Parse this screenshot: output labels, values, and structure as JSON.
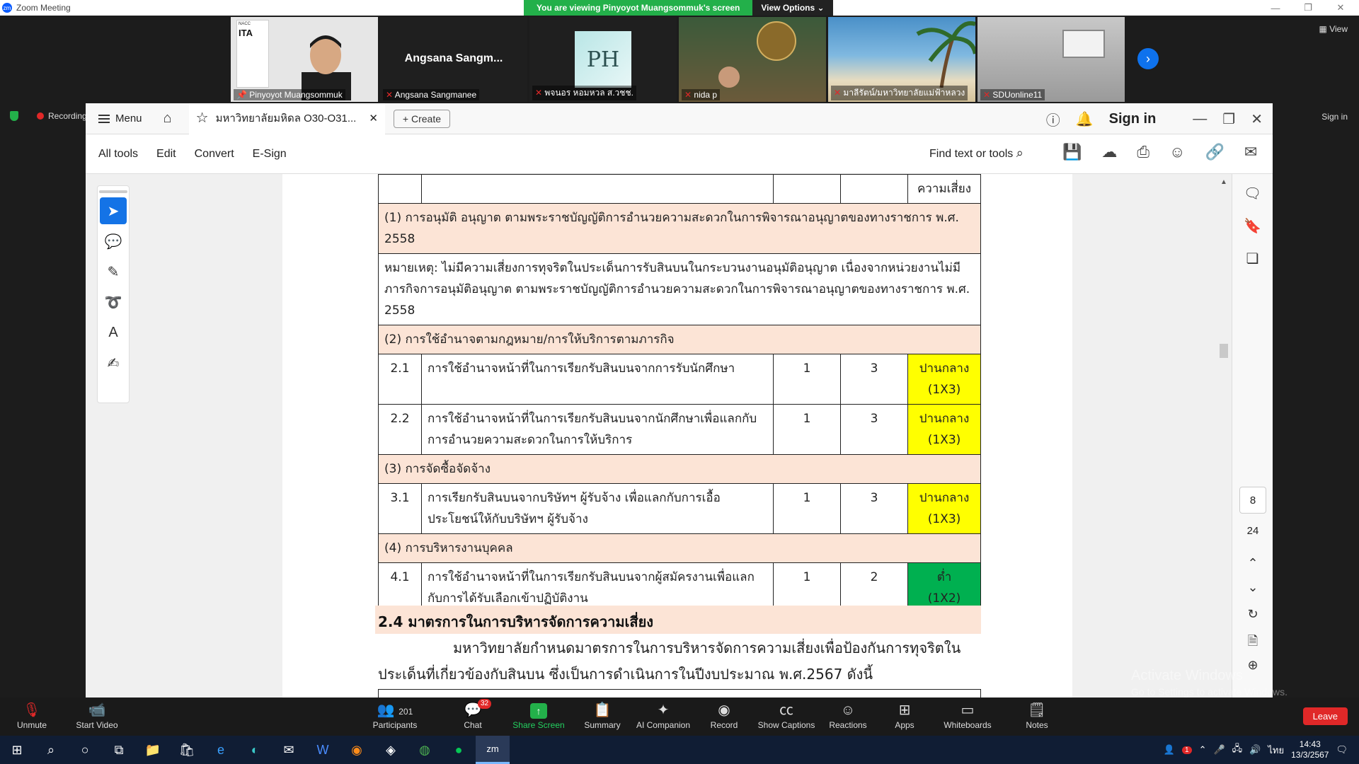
{
  "window": {
    "title": "Zoom Meeting",
    "app_icon": "zm"
  },
  "banner": {
    "message": "You are viewing Pinyoyot Muangsommuk's screen",
    "view_options": "View Options"
  },
  "participants": [
    {
      "name": "Pinyoyot Muangsommuk",
      "logo": "ITA"
    },
    {
      "name": "Angsana Sangmanee",
      "display": "Angsana  Sangm..."
    },
    {
      "name": "พจนอร หอมหวล ส.วชช.",
      "logo": "PH"
    },
    {
      "name": "nida p"
    },
    {
      "name": "มาลีรัตน์/มหาวิทยาลัยแม่ฟ้าหลวง"
    },
    {
      "name": "SDUonline11"
    }
  ],
  "view_label": "View",
  "recording_label": "Recording",
  "side_signin": "Sign in",
  "acrobat": {
    "menu_label": "Menu",
    "doc_tab_title": "มหาวิทยาลัยมหิดล O30-O31...",
    "create_label": "Create",
    "signin": "Sign in",
    "tools": [
      "All tools",
      "Edit",
      "Convert",
      "E-Sign"
    ],
    "find_label": "Find text or tools",
    "page_current": "8",
    "page_total": "24"
  },
  "document": {
    "top_level_label": "ความเสี่ยง",
    "sec1": "(1) การอนุมัติ อนุญาต ตามพระราชบัญญัติการอำนวยความสะดวกในการพิจารณาอนุญาตของทางราชการ พ.ศ. 2558",
    "note": "หมายเหตุ: ไม่มีความเสี่ยงการทุจริตในประเด็นการรับสินบนในกระบวนงานอนุมัติอนุญาต เนื่องจากหน่วยงานไม่มีภารกิจการอนุมัติอนุญาต ตามพระราชบัญญัติการอำนวยความสะดวกในการพิจารณาอนุญาตของทางราชการ พ.ศ. 2558",
    "sec2": "(2) การใช้อำนาจตามกฎหมาย/การให้บริการตามภารกิจ",
    "rows2": [
      {
        "no": "2.1",
        "text": "การใช้อำนาจหน้าที่ในการเรียกรับสินบนจากการรับนักศึกษา",
        "a": "1",
        "b": "3",
        "level": "ปานกลาง",
        "calc": "(1X3)"
      },
      {
        "no": "2.2",
        "text": "การใช้อำนาจหน้าที่ในการเรียกรับสินบนจากนักศึกษาเพื่อแลกกับการอำนวยความสะดวกในการให้บริการ",
        "a": "1",
        "b": "3",
        "level": "ปานกลาง",
        "calc": "(1X3)"
      }
    ],
    "sec3": "(3) การจัดซื้อจัดจ้าง",
    "rows3": [
      {
        "no": "3.1",
        "text": "การเรียกรับสินบนจากบริษัทฯ ผู้รับจ้าง เพื่อแลกกับการเอื้อประโยชน์ให้กับบริษัทฯ ผู้รับจ้าง",
        "a": "1",
        "b": "3",
        "level": "ปานกลาง",
        "calc": "(1X3)"
      }
    ],
    "sec4": "(4) การบริหารงานบุคคล",
    "rows4": [
      {
        "no": "4.1",
        "text": "การใช้อำนาจหน้าที่ในการเรียกรับสินบนจากผู้สมัครงานเพื่อแลกกับการได้รับเลือกเข้าปฏิบัติงาน",
        "a": "1",
        "b": "2",
        "level": "ต่ำ",
        "calc": "(1X2)"
      }
    ],
    "heading": "2.4 มาตรการในการบริหารจัดการความเสี่ยง",
    "paragraph": "มหาวิทยาลัยกำหนดมาตรการในการบริหารจัดการความเสี่ยงเพื่อป้องกันการทุจริตในประเด็นที่เกี่ยวข้องกับสินบน ซึ่งเป็นการดำเนินการในปีงบประมาณ พ.ศ.2567 ดังนี้",
    "colors": {
      "section_fill": "#fce4d6",
      "medium": "#ffff00",
      "low": "#00b050"
    }
  },
  "watermark": {
    "line1": "Activate Windows",
    "line2": "Go to Settings to activate Windows."
  },
  "zoom_toolbar": {
    "unmute": "Unmute",
    "start_video": "Start Video",
    "participants": "Participants",
    "participants_count": "201",
    "chat": "Chat",
    "chat_badge": "32",
    "share_screen": "Share Screen",
    "summary": "Summary",
    "ai_companion": "AI Companion",
    "record": "Record",
    "captions": "Show Captions",
    "reactions": "Reactions",
    "apps": "Apps",
    "whiteboards": "Whiteboards",
    "notes": "Notes",
    "leave": "Leave"
  },
  "taskbar": {
    "time": "14:43",
    "date": "13/3/2567",
    "lang": "ไทย",
    "notif_badge": "1"
  }
}
